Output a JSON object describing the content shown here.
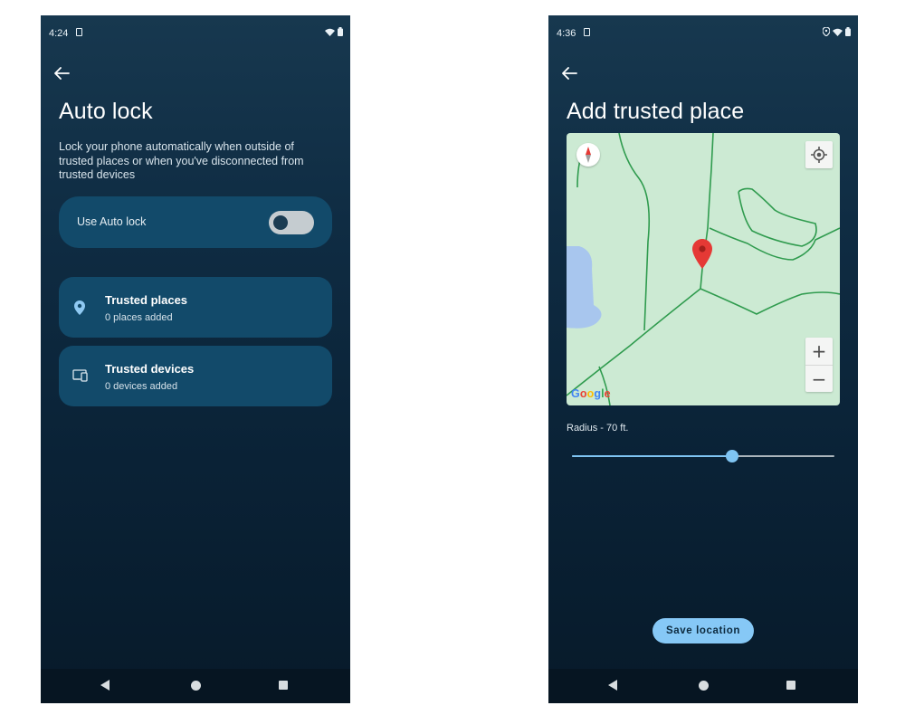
{
  "left_screen": {
    "status_bar": {
      "time": "4:24"
    },
    "title": "Auto lock",
    "description": "Lock your phone automatically when outside of trusted places or when you've disconnected from trusted devices",
    "toggle": {
      "label": "Use Auto lock",
      "state": "off"
    },
    "cards": [
      {
        "icon": "location-pin-icon",
        "title": "Trusted places",
        "subtitle": "0 places added"
      },
      {
        "icon": "devices-icon",
        "title": "Trusted devices",
        "subtitle": "0 devices added"
      }
    ]
  },
  "right_screen": {
    "status_bar": {
      "time": "4:36"
    },
    "title": "Add trusted place",
    "map": {
      "attribution": "Google",
      "zoom_in_label": "+",
      "zoom_out_label": "−"
    },
    "radius": {
      "label": "Radius - 70 ft.",
      "slider_fraction": 0.61
    },
    "save_button": "Save location"
  },
  "colors": {
    "card_bg": "#124a6a",
    "accent": "#86c8f6",
    "map_bg": "#ccead3",
    "map_road": "#2f9b4e",
    "pin": "#e53935"
  }
}
